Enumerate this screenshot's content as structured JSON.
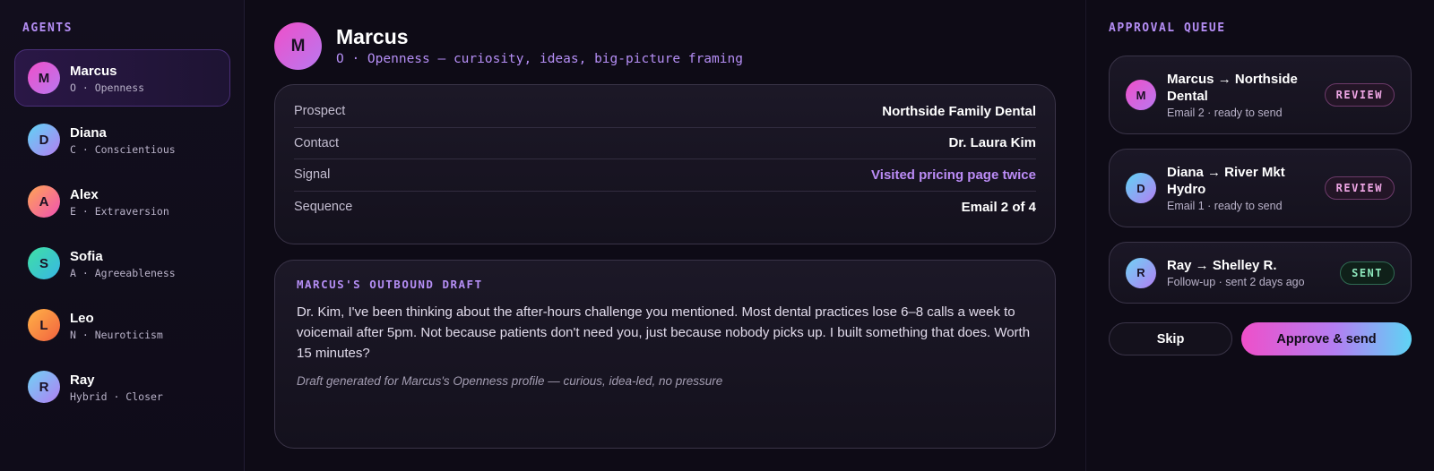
{
  "sidebar": {
    "title": "AGENTS",
    "items": [
      {
        "initial": "M",
        "name": "Marcus",
        "trait": "O · Openness",
        "gradient": [
          "#ef4fc9",
          "#b978f0"
        ]
      },
      {
        "initial": "D",
        "name": "Diana",
        "trait": "C · Conscientious",
        "gradient": [
          "#5fd4f5",
          "#b47ef2"
        ]
      },
      {
        "initial": "A",
        "name": "Alex",
        "trait": "E · Extraversion",
        "gradient": [
          "#ffa553",
          "#f052b4"
        ]
      },
      {
        "initial": "S",
        "name": "Sofia",
        "trait": "A · Agreeableness",
        "gradient": [
          "#3fe0a4",
          "#38b6e6"
        ]
      },
      {
        "initial": "L",
        "name": "Leo",
        "trait": "N · Neuroticism",
        "gradient": [
          "#ffb347",
          "#f2613f"
        ]
      },
      {
        "initial": "R",
        "name": "Ray",
        "trait": "Hybrid · Closer",
        "gradient": [
          "#6fd3f5",
          "#b17ef2"
        ]
      }
    ]
  },
  "header": {
    "initial": "M",
    "name": "Marcus",
    "subtitle": "O · Openness — curiosity, ideas, big-picture framing"
  },
  "details": [
    {
      "label": "Prospect",
      "value": "Northside Family Dental",
      "accent": false
    },
    {
      "label": "Contact",
      "value": "Dr. Laura Kim",
      "accent": false
    },
    {
      "label": "Signal",
      "value": "Visited pricing page twice",
      "accent": true
    },
    {
      "label": "Sequence",
      "value": "Email 2 of 4",
      "accent": false
    }
  ],
  "draft": {
    "title": "MARCUS'S OUTBOUND DRAFT",
    "body": "Dr. Kim, I've been thinking about the after-hours challenge you mentioned. Most dental practices lose 6–8 calls a week to voicemail after 5pm. Not because patients don't need you, just because nobody picks up. I built something that does. Worth 15 minutes?",
    "note": "Draft generated for Marcus's Openness profile — curious, idea-led, no pressure"
  },
  "queue": {
    "title": "APPROVAL QUEUE",
    "items": [
      {
        "initial": "M",
        "title": "Marcus → Northside Dental",
        "sub": "Email 2 · ready to send",
        "badge": "REVIEW",
        "status": "review",
        "gradient": [
          "#ef4fc9",
          "#b978f0"
        ]
      },
      {
        "initial": "D",
        "title": "Diana → River Mkt Hydro",
        "sub": "Email 1 · ready to send",
        "badge": "REVIEW",
        "status": "review",
        "gradient": [
          "#5fd4f5",
          "#b47ef2"
        ]
      },
      {
        "initial": "R",
        "title": "Ray → Shelley R.",
        "sub": "Follow-up · sent 2 days ago",
        "badge": "SENT",
        "status": "sent",
        "gradient": [
          "#6fd3f5",
          "#b17ef2"
        ]
      }
    ],
    "skip_label": "Skip",
    "approve_label": "Approve & send"
  }
}
